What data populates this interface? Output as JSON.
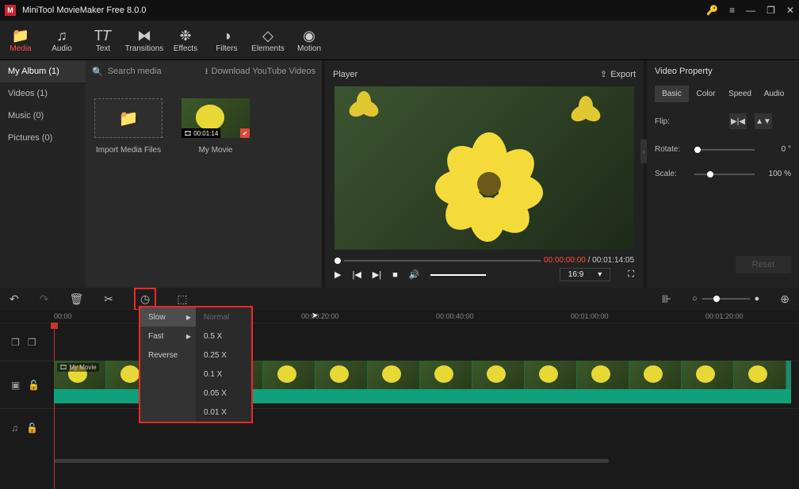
{
  "app": {
    "title": "MiniTool MovieMaker Free 8.0.0"
  },
  "maintabs": [
    {
      "label": "Media"
    },
    {
      "label": "Audio"
    },
    {
      "label": "Text"
    },
    {
      "label": "Transitions"
    },
    {
      "label": "Effects"
    },
    {
      "label": "Filters"
    },
    {
      "label": "Elements"
    },
    {
      "label": "Motion"
    }
  ],
  "sidebar": {
    "items": [
      {
        "label": "My Album (1)"
      },
      {
        "label": "Videos (1)"
      },
      {
        "label": "Music (0)"
      },
      {
        "label": "Pictures (0)"
      }
    ]
  },
  "mediabar": {
    "search": "Search media",
    "download": "Download YouTube Videos"
  },
  "thumbs": {
    "import": "Import Media Files",
    "clip_label": "My Movie",
    "clip_duration": "00:01:14"
  },
  "player": {
    "title": "Player",
    "export": "Export",
    "time_current": "00:00:00:00",
    "time_total": "00:01:14:05",
    "aspect": "16:9"
  },
  "props": {
    "title": "Video Property",
    "tabs": [
      "Basic",
      "Color",
      "Speed",
      "Audio"
    ],
    "flip": "Flip:",
    "rotate": "Rotate:",
    "rotate_value": "0 °",
    "scale": "Scale:",
    "scale_value": "100 %",
    "reset": "Reset"
  },
  "timeline": {
    "ticks": [
      "00:00",
      "00:00:20:00",
      "00:00:40:00",
      "00:01:00:00",
      "00:01:20:00"
    ],
    "clip_name": "My Movie"
  },
  "speedmenu": {
    "col1": [
      "Slow",
      "Fast",
      "Reverse"
    ],
    "col2": [
      "Normal",
      "0.5 X",
      "0.25 X",
      "0.1 X",
      "0.05 X",
      "0.01 X"
    ]
  }
}
